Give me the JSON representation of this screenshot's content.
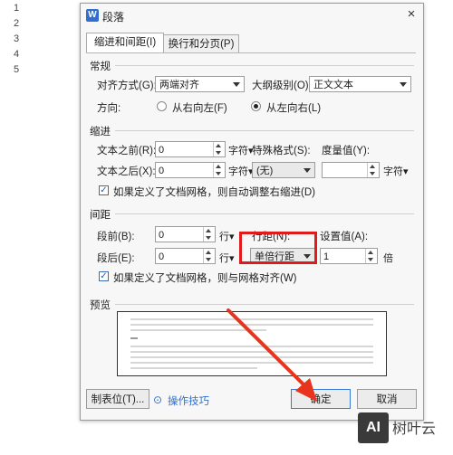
{
  "line_numbers": [
    "1",
    "2",
    "3",
    "4",
    "5"
  ],
  "dialog": {
    "title": "段落",
    "close": "×",
    "tabs": [
      "缩进和间距(I)",
      "换行和分页(P)"
    ],
    "general": {
      "section": "常规",
      "align_label": "对齐方式(G):",
      "align_value": "两端对齐",
      "outline_label": "大纲级别(O):",
      "outline_value": "正文文本",
      "direction_label": "方向:",
      "rtl_label": "从右向左(F)",
      "ltr_label": "从左向右(L)",
      "selected_direction": "ltr"
    },
    "indent": {
      "section": "缩进",
      "before_label": "文本之前(R):",
      "before_value": "0",
      "before_unit": "字符",
      "special_label": "特殊格式(S):",
      "special_value": "(无)",
      "measure_label": "度量值(Y):",
      "measure_value": "",
      "measure_unit": "字符",
      "after_label": "文本之后(X):",
      "after_value": "0",
      "after_unit": "字符",
      "grid_check_label": "如果定义了文档网格，则自动调整右缩进(D)",
      "grid_checked": true
    },
    "spacing": {
      "section": "间距",
      "before_label": "段前(B):",
      "before_value": "0",
      "before_unit": "行",
      "line_spacing_label": "行距(N):",
      "line_spacing_value": "单倍行距",
      "set_value_label": "设置值(A):",
      "set_value": "1",
      "set_unit": "倍",
      "after_label": "段后(E):",
      "after_value": "0",
      "after_unit": "行",
      "grid_check_label": "如果定义了文档网格，则与网格对齐(W)",
      "grid_checked": true
    },
    "preview": {
      "section": "预览"
    },
    "footer": {
      "tabs_button": "制表位(T)...",
      "tips_link": "操作技巧",
      "ok_button": "确定",
      "cancel_button": "取消"
    }
  },
  "watermark": {
    "badge": "AI",
    "text": "树叶云"
  },
  "colors": {
    "highlight_box": "#e01b1b",
    "arrow": "#e8341c",
    "accent": "#2f6fd1"
  }
}
